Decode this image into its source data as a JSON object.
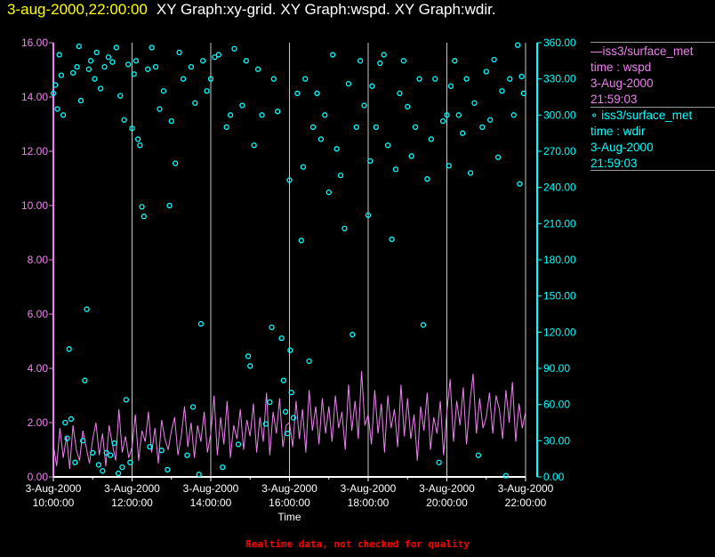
{
  "header": {
    "timestamp": "3-aug-2000,22:00:00",
    "graphs": "XY Graph:xy-grid.  XY Graph:wspd.  XY Graph:wdir."
  },
  "legend": [
    {
      "line1": "—iss3/surface_met",
      "line2": "time : wspd",
      "line3": "3-Aug-2000",
      "line4": "21:59:03"
    },
    {
      "line1": "∘ iss3/surface_met",
      "line2": "time : wdir",
      "line3": "3-Aug-2000",
      "line4": "21:59:03"
    }
  ],
  "footer": "Realtime data, not checked for quality",
  "colors": {
    "wspd": "#ee82ee",
    "wdir": "#00ffff",
    "grid": "#c8c8c8",
    "axis": "#ffffff"
  },
  "chart_data": {
    "type": "line+scatter",
    "xlabel": "Time",
    "xlim_hours": [
      10,
      22
    ],
    "x_ticks": [
      {
        "date": "3-Aug-2000",
        "time": "10:00:00"
      },
      {
        "date": "3-Aug-2000",
        "time": "12:00:00"
      },
      {
        "date": "3-Aug-2000",
        "time": "14:00:00"
      },
      {
        "date": "3-Aug-2000",
        "time": "16:00:00"
      },
      {
        "date": "3-Aug-2000",
        "time": "18:00:00"
      },
      {
        "date": "3-Aug-2000",
        "time": "20:00:00"
      },
      {
        "date": "3-Aug-2000",
        "time": "22:00:00"
      }
    ],
    "y_left": {
      "series": "wspd",
      "ylim": [
        0,
        16
      ],
      "ticks": [
        "0.00",
        "2.00",
        "4.00",
        "6.00",
        "8.00",
        "10.00",
        "12.00",
        "14.00",
        "16.00"
      ]
    },
    "y_right": {
      "series": "wdir",
      "ylim": [
        0,
        360
      ],
      "ticks": [
        "0.00",
        "30.00",
        "60.00",
        "90.00",
        "120.00",
        "150.00",
        "180.00",
        "210.00",
        "240.00",
        "270.00",
        "300.00",
        "330.00",
        "360.00"
      ]
    },
    "grid": "vertical every 2 hours",
    "series": [
      {
        "name": "wspd",
        "type": "line",
        "x_start_hour": 10,
        "x_step_minutes": 5,
        "values": [
          1.2,
          0.4,
          1.8,
          0.7,
          1.5,
          0.3,
          1.9,
          1.0,
          0.6,
          1.7,
          1.1,
          0.5,
          1.4,
          2.0,
          0.8,
          1.6,
          0.4,
          1.9,
          1.2,
          0.6,
          2.5,
          0.9,
          1.5,
          0.7,
          1.1,
          2.3,
          0.6,
          1.7,
          1.3,
          2.4,
          0.9,
          1.8,
          0.5,
          2.1,
          1.4,
          1.0,
          1.7,
          2.2,
          0.8,
          1.5,
          2.6,
          1.1,
          2.0,
          0.7,
          1.9,
          1.3,
          2.4,
          0.9,
          1.6,
          3.0,
          0.8,
          2.2,
          1.2,
          2.8,
          0.7,
          1.9,
          1.4,
          2.5,
          1.0,
          2.1,
          1.5,
          2.7,
          0.9,
          2.2,
          1.3,
          3.1,
          0.8,
          2.4,
          1.6,
          2.9,
          1.1,
          1.9,
          2.0,
          1.1,
          2.8,
          1.4,
          2.5,
          0.9,
          3.2,
          1.7,
          2.6,
          1.2,
          2.9,
          1.6,
          2.6,
          1.3,
          3.0,
          1.8,
          2.4,
          1.0,
          3.4,
          1.7,
          2.8,
          1.4,
          3.9,
          1.9,
          2.3,
          1.2,
          3.2,
          1.6,
          2.7,
          0.9,
          3.0,
          1.8,
          2.5,
          1.1,
          3.4,
          1.5,
          2.9,
          1.4,
          2.3,
          0.6,
          2.6,
          1.7,
          3.1,
          1.0,
          2.2,
          1.6,
          2.8,
          0.8,
          2.4,
          3.6,
          1.3,
          2.8,
          1.9,
          3.3,
          1.2,
          2.7,
          3.8,
          1.6,
          2.9,
          1.8,
          2.2,
          3.1,
          1.6,
          3.0,
          2.5,
          1.4,
          3.2,
          2.0,
          3.5,
          1.3,
          2.7,
          1.8,
          2.4
        ]
      },
      {
        "name": "wdir",
        "type": "scatter",
        "points": [
          [
            10.0,
            318
          ],
          [
            10.05,
            325
          ],
          [
            10.1,
            305
          ],
          [
            10.15,
            350
          ],
          [
            10.2,
            333
          ],
          [
            10.25,
            300
          ],
          [
            10.3,
            45
          ],
          [
            10.35,
            32
          ],
          [
            10.4,
            106
          ],
          [
            10.45,
            48
          ],
          [
            10.5,
            335
          ],
          [
            10.55,
            12
          ],
          [
            10.6,
            340
          ],
          [
            10.65,
            357
          ],
          [
            10.7,
            312
          ],
          [
            10.75,
            30
          ],
          [
            10.8,
            80
          ],
          [
            10.85,
            139
          ],
          [
            10.9,
            338
          ],
          [
            10.95,
            345
          ],
          [
            11.0,
            20
          ],
          [
            11.05,
            330
          ],
          [
            11.1,
            352
          ],
          [
            11.15,
            10
          ],
          [
            11.2,
            322
          ],
          [
            11.25,
            5
          ],
          [
            11.3,
            340
          ],
          [
            11.35,
            20
          ],
          [
            11.4,
            348
          ],
          [
            11.45,
            18
          ],
          [
            11.5,
            344
          ],
          [
            11.55,
            28
          ],
          [
            11.6,
            356
          ],
          [
            11.65,
            3
          ],
          [
            11.7,
            316
          ],
          [
            11.75,
            8
          ],
          [
            11.8,
            296
          ],
          [
            11.85,
            64
          ],
          [
            11.9,
            342
          ],
          [
            11.95,
            12
          ],
          [
            12.0,
            289
          ],
          [
            12.05,
            334
          ],
          [
            12.1,
            345
          ],
          [
            12.15,
            280
          ],
          [
            12.2,
            275
          ],
          [
            12.25,
            224
          ],
          [
            12.3,
            216
          ],
          [
            12.4,
            338
          ],
          [
            12.45,
            25
          ],
          [
            12.5,
            356
          ],
          [
            12.6,
            340
          ],
          [
            12.7,
            305
          ],
          [
            12.75,
            22
          ],
          [
            12.8,
            320
          ],
          [
            12.9,
            6
          ],
          [
            12.95,
            225
          ],
          [
            13.0,
            295
          ],
          [
            13.1,
            260
          ],
          [
            13.2,
            352
          ],
          [
            13.3,
            330
          ],
          [
            13.4,
            18
          ],
          [
            13.5,
            340
          ],
          [
            13.55,
            58
          ],
          [
            13.6,
            310
          ],
          [
            13.7,
            2
          ],
          [
            13.75,
            127
          ],
          [
            13.8,
            345
          ],
          [
            13.9,
            320
          ],
          [
            14.0,
            330
          ],
          [
            14.1,
            348
          ],
          [
            14.2,
            350
          ],
          [
            14.3,
            8
          ],
          [
            14.4,
            290
          ],
          [
            14.5,
            300
          ],
          [
            14.6,
            355
          ],
          [
            14.7,
            27
          ],
          [
            14.8,
            308
          ],
          [
            14.9,
            345
          ],
          [
            14.95,
            100
          ],
          [
            15.0,
            92
          ],
          [
            15.1,
            275
          ],
          [
            15.2,
            338
          ],
          [
            15.3,
            300
          ],
          [
            15.4,
            44
          ],
          [
            15.5,
            62
          ],
          [
            15.55,
            124
          ],
          [
            15.6,
            330
          ],
          [
            15.7,
            303
          ],
          [
            15.8,
            115
          ],
          [
            15.85,
            80
          ],
          [
            15.9,
            54
          ],
          [
            15.95,
            36
          ],
          [
            16.0,
            246
          ],
          [
            16.02,
            105
          ],
          [
            16.05,
            70
          ],
          [
            16.1,
            49
          ],
          [
            16.2,
            318
          ],
          [
            16.3,
            196
          ],
          [
            16.35,
            257
          ],
          [
            16.4,
            330
          ],
          [
            16.5,
            96
          ],
          [
            16.6,
            290
          ],
          [
            16.7,
            318
          ],
          [
            16.8,
            280
          ],
          [
            16.9,
            300
          ],
          [
            17.0,
            236
          ],
          [
            17.1,
            350
          ],
          [
            17.2,
            272
          ],
          [
            17.3,
            250
          ],
          [
            17.4,
            206
          ],
          [
            17.5,
            326
          ],
          [
            17.6,
            118
          ],
          [
            17.7,
            290
          ],
          [
            17.8,
            345
          ],
          [
            17.9,
            308
          ],
          [
            18.0,
            217
          ],
          [
            18.05,
            262
          ],
          [
            18.1,
            324
          ],
          [
            18.2,
            290
          ],
          [
            18.3,
            343
          ],
          [
            18.4,
            350
          ],
          [
            18.5,
            275
          ],
          [
            18.6,
            197
          ],
          [
            18.7,
            255
          ],
          [
            18.8,
            318
          ],
          [
            18.9,
            345
          ],
          [
            19.0,
            307
          ],
          [
            19.1,
            266
          ],
          [
            19.2,
            290
          ],
          [
            19.3,
            330
          ],
          [
            19.4,
            126
          ],
          [
            19.5,
            247
          ],
          [
            19.6,
            280
          ],
          [
            19.7,
            330
          ],
          [
            19.8,
            12
          ],
          [
            19.9,
            295
          ],
          [
            20.0,
            300
          ],
          [
            20.05,
            258
          ],
          [
            20.1,
            324
          ],
          [
            20.2,
            345
          ],
          [
            20.3,
            300
          ],
          [
            20.4,
            285
          ],
          [
            20.5,
            330
          ],
          [
            20.6,
            252
          ],
          [
            20.7,
            310
          ],
          [
            20.8,
            18
          ],
          [
            20.9,
            290
          ],
          [
            21.0,
            336
          ],
          [
            21.1,
            296
          ],
          [
            21.2,
            346
          ],
          [
            21.3,
            265
          ],
          [
            21.4,
            320
          ],
          [
            21.5,
            1
          ],
          [
            21.6,
            330
          ],
          [
            21.7,
            300
          ],
          [
            21.8,
            358
          ],
          [
            21.85,
            243
          ],
          [
            21.9,
            332
          ],
          [
            21.95,
            318
          ]
        ]
      }
    ]
  }
}
